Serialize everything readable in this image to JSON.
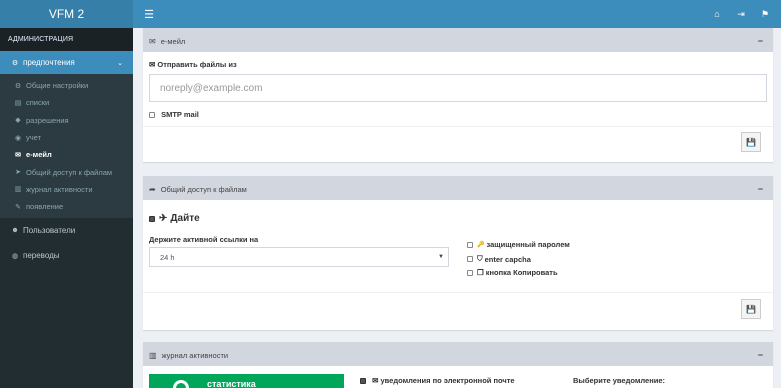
{
  "app": {
    "logo": "VFM 2"
  },
  "topbar": {
    "menu_icon": "☰",
    "home_icon": "⌂",
    "logout_icon": "⇥",
    "flag_icon": "⚑"
  },
  "sidebar": {
    "header": "АДМИНИСТРАЦИЯ",
    "parent": {
      "label": "предпочтения",
      "icon": "⚙",
      "chevron": "⌄"
    },
    "items": [
      {
        "label": "Общие настройки",
        "icon": "⚙"
      },
      {
        "label": "списки",
        "icon": "▤"
      },
      {
        "label": "разрешения",
        "icon": "◆"
      },
      {
        "label": "учет",
        "icon": "◉"
      },
      {
        "label": "e-мейл",
        "icon": "✉"
      },
      {
        "label": "Общий доступ к файлам",
        "icon": "➤"
      },
      {
        "label": "журнал активности",
        "icon": "▥"
      },
      {
        "label": "появление",
        "icon": "✎"
      }
    ],
    "users": {
      "label": "Пользователи",
      "icon": "☻"
    },
    "translations": {
      "label": "переводы",
      "icon": "◍"
    }
  },
  "email_panel": {
    "title": "e-мейл",
    "icon": "✉",
    "collapse": "−",
    "send_from_label": "Отправить файлы из",
    "send_from_icon": "✉",
    "send_from_placeholder": "noreply@example.com",
    "smtp_label": "SMTP mail",
    "save_icon": "💾"
  },
  "share_panel": {
    "title": "Общий доступ к файлам",
    "icon": "➦",
    "collapse": "−",
    "enable_label": "Дайте",
    "enable_icon": "✈",
    "keep_links_label": "Держите активной ссылки на",
    "keep_links_value": "24 h",
    "options": [
      {
        "label": "защищенный паролем",
        "icon": "🔑"
      },
      {
        "label": "enter capcha",
        "icon": "⛉"
      },
      {
        "label": "кнопка Копировать",
        "icon": "❐"
      }
    ],
    "save_icon": "💾"
  },
  "activity_panel": {
    "title": "журнал активности",
    "icon": "▥",
    "collapse": "−",
    "stats_label": "статистика",
    "email_notify_label": "уведомления по электронной почте",
    "email_notify_icon": "✉",
    "choose_notify_label": "Выберите уведомление:"
  },
  "colors": {
    "primary": "#3c8dbc",
    "sidebar": "#222d32",
    "success": "#00a65a"
  }
}
